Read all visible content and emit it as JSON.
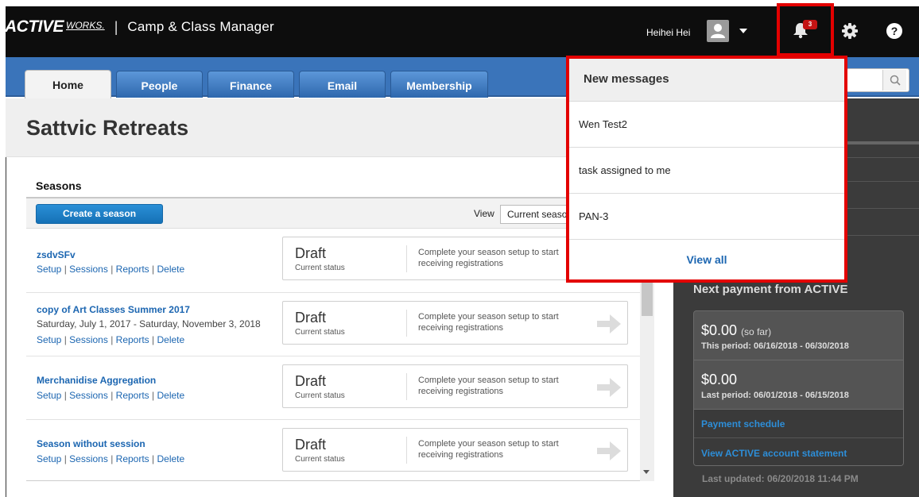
{
  "header": {
    "brand_active": "ACTIVE",
    "brand_works": "WORKS.",
    "brand_separator": "|",
    "app_name": "Camp & Class Manager",
    "user_name": "Heihei Hei",
    "notification_count": "3",
    "help_label": "?"
  },
  "tabs": [
    {
      "label": "Home",
      "active": true
    },
    {
      "label": "People",
      "active": false
    },
    {
      "label": "Finance",
      "active": false
    },
    {
      "label": "Email",
      "active": false
    },
    {
      "label": "Membership",
      "active": false
    }
  ],
  "page": {
    "title": "Sattvic Retreats"
  },
  "seasons": {
    "heading": "Seasons",
    "create_button": "Create a season",
    "view_label": "View",
    "view_value": "Current seasons",
    "rows": [
      {
        "name": "zsdvSFv",
        "dates": "",
        "links": [
          "Setup",
          "Sessions",
          "Reports",
          "Delete"
        ],
        "status": "Draft",
        "status_sub": "Current status",
        "message": "Complete your season setup to start receiving registrations"
      },
      {
        "name": "copy of Art Classes Summer 2017",
        "dates": "Saturday, July 1, 2017 - Saturday, November 3, 2018",
        "links": [
          "Setup",
          "Sessions",
          "Reports",
          "Delete"
        ],
        "status": "Draft",
        "status_sub": "Current status",
        "message": "Complete your season setup to start receiving registrations"
      },
      {
        "name": "Merchanidise Aggregation",
        "dates": "",
        "links": [
          "Setup",
          "Sessions",
          "Reports",
          "Delete"
        ],
        "status": "Draft",
        "status_sub": "Current status",
        "message": "Complete your season setup to start receiving registrations"
      },
      {
        "name": "Season without session",
        "dates": "",
        "links": [
          "Setup",
          "Sessions",
          "Reports",
          "Delete"
        ],
        "status": "Draft",
        "status_sub": "Current status",
        "message": "Complete your season setup to start receiving registrations"
      }
    ]
  },
  "payments": {
    "heading": "Next payment from ACTIVE",
    "current_amount": "$0.00",
    "current_note": "(so far)",
    "current_period": "This period: 06/16/2018 - 06/30/2018",
    "last_amount": "$0.00",
    "last_period": "Last period: 06/01/2018 - 06/15/2018",
    "schedule_link": "Payment schedule",
    "statement_link": "View ACTIVE account statement",
    "last_updated": "Last updated: 06/20/2018 11:44 PM"
  },
  "notifications": {
    "title": "New messages",
    "items": [
      "Wen Test2",
      "task assigned to me",
      "PAN-3"
    ],
    "view_all": "View all"
  },
  "colors": {
    "topbar": "#0d0d0d",
    "tabbar": "#3a74ba",
    "link": "#1c66b1",
    "highlight": "#e30000",
    "right_panel": "#3b3b3b"
  },
  "icons": {
    "avatar": "user-avatar-icon",
    "bell": "bell-icon",
    "gear": "gear-icon",
    "help": "help-icon",
    "search": "search-icon",
    "arrow": "arrow-right-icon"
  }
}
